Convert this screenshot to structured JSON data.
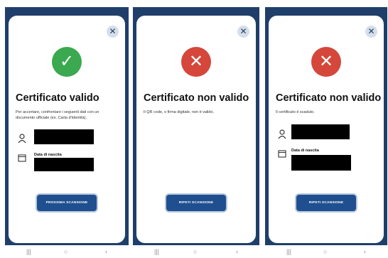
{
  "screens": [
    {
      "close_icon": "✕",
      "status": "valid",
      "status_glyph": "✓",
      "title": "Certificato valido",
      "description": "Per accertare, confrontare i seguenti dati con un documento ufficiale (es. Carta d'Identità).",
      "birth_date_label": "Data di nascita",
      "button_label": "PROSSIMA SCANSIONE"
    },
    {
      "close_icon": "✕",
      "status": "invalid",
      "status_glyph": "✕",
      "title": "Certificato non valido",
      "description": "Il QR code, o firma digitale, non è valido.",
      "button_label": "RIPETI SCANSIONE"
    },
    {
      "close_icon": "✕",
      "status": "invalid",
      "status_glyph": "✕",
      "title": "Certificato non valido",
      "description": "Il certificato è scaduto.",
      "birth_date_label": "Data di nascita",
      "button_label": "RIPETI SCANSIONE"
    }
  ],
  "navbar": {
    "left": "|||",
    "center": "○",
    "right": "‹"
  },
  "colors": {
    "header_blue": "#1f3f6a",
    "success_green": "#3aa94f",
    "error_red": "#d4473a",
    "button_blue": "#1f4f8f"
  },
  "icons": {
    "person": "person-icon",
    "calendar": "calendar-icon",
    "close": "close-icon"
  }
}
